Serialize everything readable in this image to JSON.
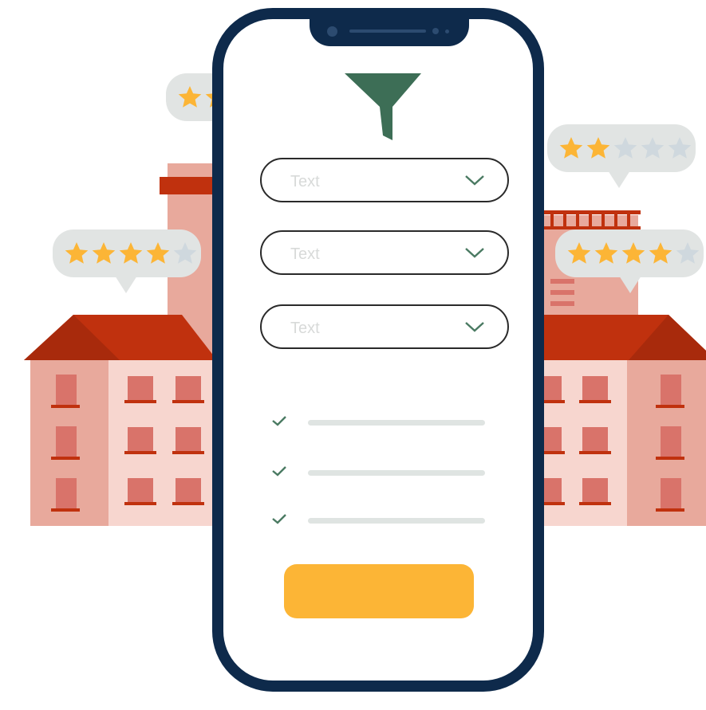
{
  "filters": {
    "fields": [
      {
        "placeholder": "Text"
      },
      {
        "placeholder": "Text"
      },
      {
        "placeholder": "Text"
      }
    ]
  },
  "checklist": {
    "items": [
      {
        "checked": true
      },
      {
        "checked": true
      },
      {
        "checked": true
      }
    ]
  },
  "ratings": [
    {
      "stars_filled": 2,
      "stars_total": 5
    },
    {
      "stars_filled": 4,
      "stars_total": 5
    },
    {
      "stars_filled": 2,
      "stars_total": 5
    },
    {
      "stars_filled": 4,
      "stars_total": 5
    }
  ],
  "colors": {
    "phone_frame": "#0e2a4b",
    "funnel": "#3d6e56",
    "cta": "#fcb536",
    "star_filled": "#fcb536",
    "star_empty": "#cfd8de",
    "roof": "#c0310e",
    "building": "#f2c4bb",
    "bubble": "#e1e4e3"
  },
  "icons": [
    "funnel-icon",
    "chevron-down-icon",
    "check-icon",
    "star-icon"
  ]
}
